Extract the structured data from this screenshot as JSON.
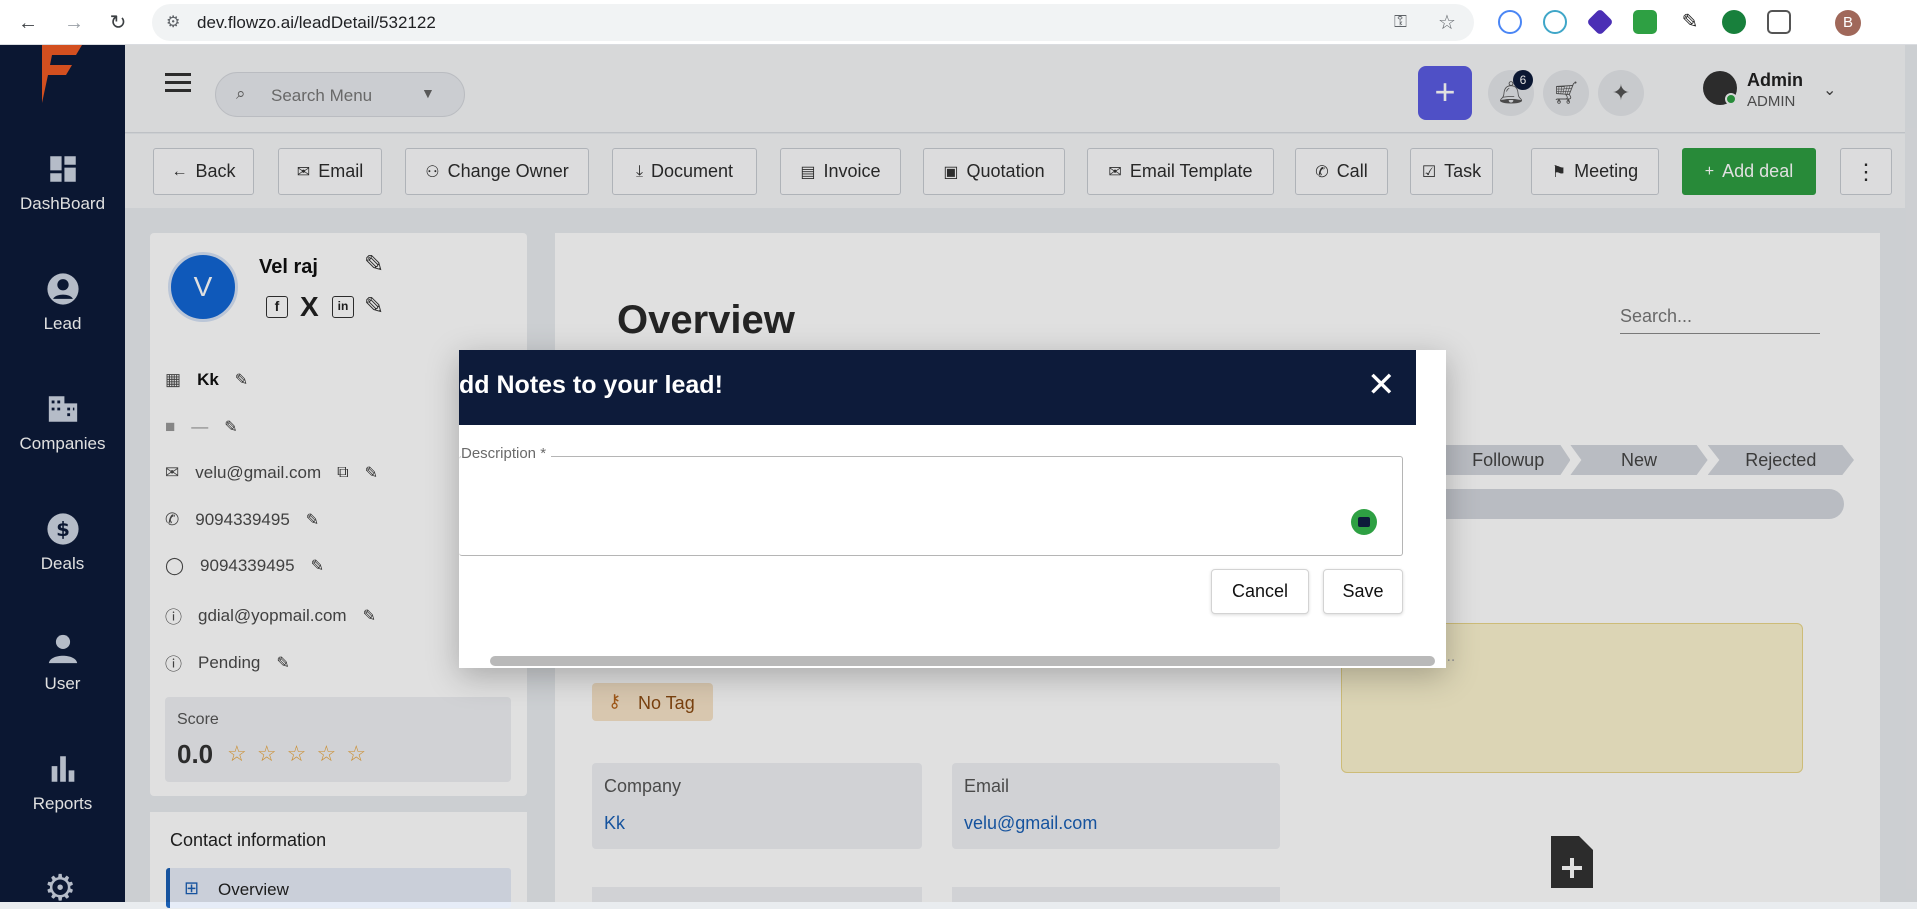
{
  "browser": {
    "url": "dev.flowzo.ai/leadDetail/532122",
    "profile_initial": "B"
  },
  "sidebar": {
    "items": [
      {
        "label": "DashBoard",
        "icon": "dashboard-icon"
      },
      {
        "label": "Lead",
        "icon": "person-icon"
      },
      {
        "label": "Companies",
        "icon": "building-icon"
      },
      {
        "label": "Deals",
        "icon": "dollar-icon"
      },
      {
        "label": "User",
        "icon": "user-icon"
      },
      {
        "label": "Reports",
        "icon": "bar-chart-icon"
      }
    ]
  },
  "header": {
    "search_placeholder": "Search Menu",
    "notifications_count": "6",
    "user_name": "Admin",
    "user_role": "ADMIN"
  },
  "toolbar": {
    "back": "Back",
    "email": "Email",
    "change_owner": "Change Owner",
    "document": "Document",
    "invoice": "Invoice",
    "quotation": "Quotation",
    "email_template": "Email Template",
    "call": "Call",
    "task": "Task",
    "meeting": "Meeting",
    "add_deal": "Add deal"
  },
  "lead": {
    "avatar_initial": "V",
    "name": "Vel raj",
    "company": "Kk",
    "job": "—",
    "email": "velu@gmail.com",
    "phone": "9094339495",
    "whatsapp": "9094339495",
    "secondary_email": "gdial@yopmail.com",
    "status": "Pending",
    "score_label": "Score",
    "score_value": "0.0",
    "stars": "☆ ☆ ☆ ☆ ☆",
    "contact_info_heading": "Contact information",
    "nav_overview": "Overview"
  },
  "main": {
    "title": "Overview",
    "search_placeholder": "Search...",
    "stages": [
      "Followup",
      "New",
      "Rejected"
    ],
    "tag": "No Tag",
    "fields": [
      {
        "label": "Company",
        "value": "Kk"
      },
      {
        "label": "Email",
        "value": "velu@gmail.com"
      }
    ],
    "note_hint": "..."
  },
  "dialog": {
    "title": "dd Notes to your lead!",
    "description_label": "Description *",
    "cancel": "Cancel",
    "save": "Save"
  },
  "colors": {
    "navy": "#0d1b3a",
    "add_deal_green": "#2e9e41",
    "plus_purple": "#5b5ce2",
    "link_blue": "#1a5fb4"
  }
}
